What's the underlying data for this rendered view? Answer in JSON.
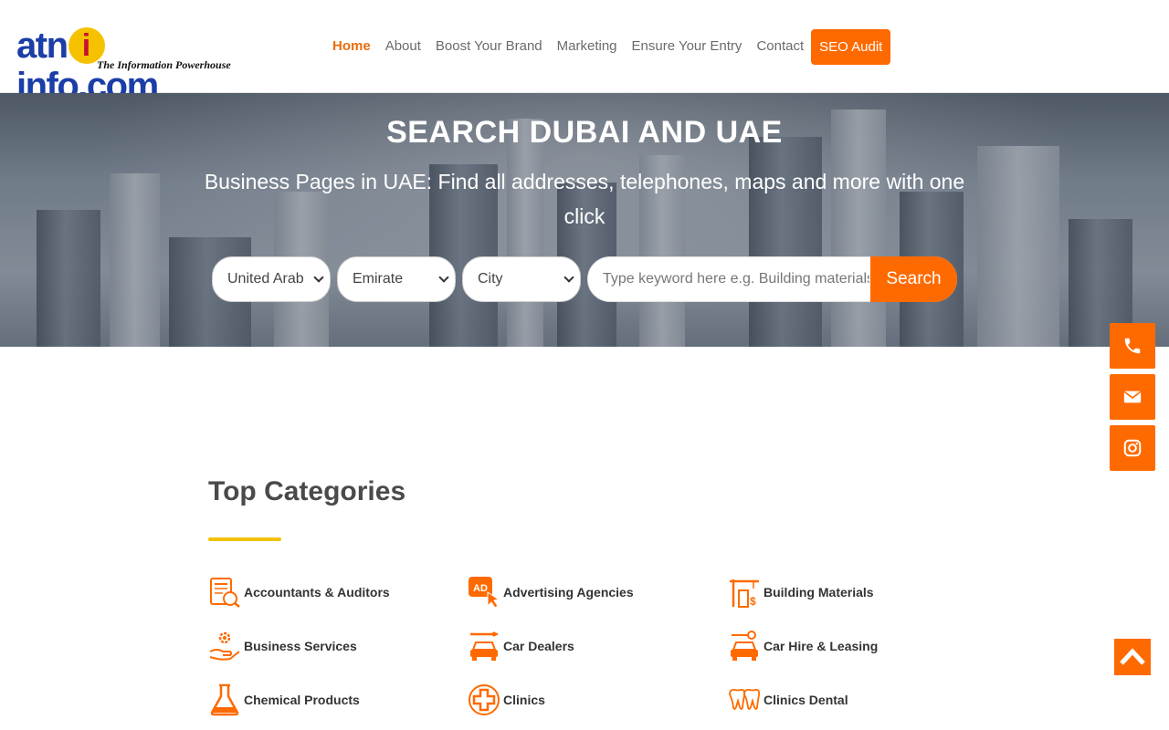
{
  "brand": {
    "logo_text_pre": "atn",
    "logo_badge": "i",
    "logo_text_post": "info.com",
    "tagline": "The Information Powerhouse"
  },
  "nav": {
    "items": [
      {
        "label": "Home",
        "active": true
      },
      {
        "label": "About"
      },
      {
        "label": "Boost Your Brand"
      },
      {
        "label": "Marketing"
      },
      {
        "label": "Ensure Your Entry"
      },
      {
        "label": "Contact"
      }
    ],
    "cta_label": "SEO Audit"
  },
  "hero": {
    "title": "SEARCH DUBAI AND UAE",
    "subtitle": "Business Pages in UAE: Find all addresses, telephones, maps and more with one click"
  },
  "search": {
    "country_value": "United Arab",
    "emirate_value": "Emirate",
    "city_value": "City",
    "placeholder": "Type keyword here e.g. Building materials",
    "button_label": "Search"
  },
  "categories": {
    "title": "Top Categories",
    "items": [
      {
        "label": "Accountants & Auditors",
        "icon": "accounting-icon"
      },
      {
        "label": "Advertising Agencies",
        "icon": "advertising-icon"
      },
      {
        "label": "Building Materials",
        "icon": "crane-icon"
      },
      {
        "label": "Business Services",
        "icon": "hand-gear-icon"
      },
      {
        "label": "Car Dealers",
        "icon": "car-icon"
      },
      {
        "label": "Car Hire & Leasing",
        "icon": "car-key-icon"
      },
      {
        "label": "Chemical Products",
        "icon": "flask-icon"
      },
      {
        "label": "Clinics",
        "icon": "medical-cross-icon"
      },
      {
        "label": "Clinics Dental",
        "icon": "tooth-icon"
      }
    ]
  },
  "floating": {
    "buttons": [
      "phone-icon",
      "email-icon",
      "instagram-icon"
    ],
    "back_to_top": "chevron-up-icon"
  },
  "colors": {
    "accent": "#ff6a00",
    "active_nav": "#ec6b0a",
    "underline": "#f2c200",
    "logo_blue": "#1b3ea8"
  }
}
